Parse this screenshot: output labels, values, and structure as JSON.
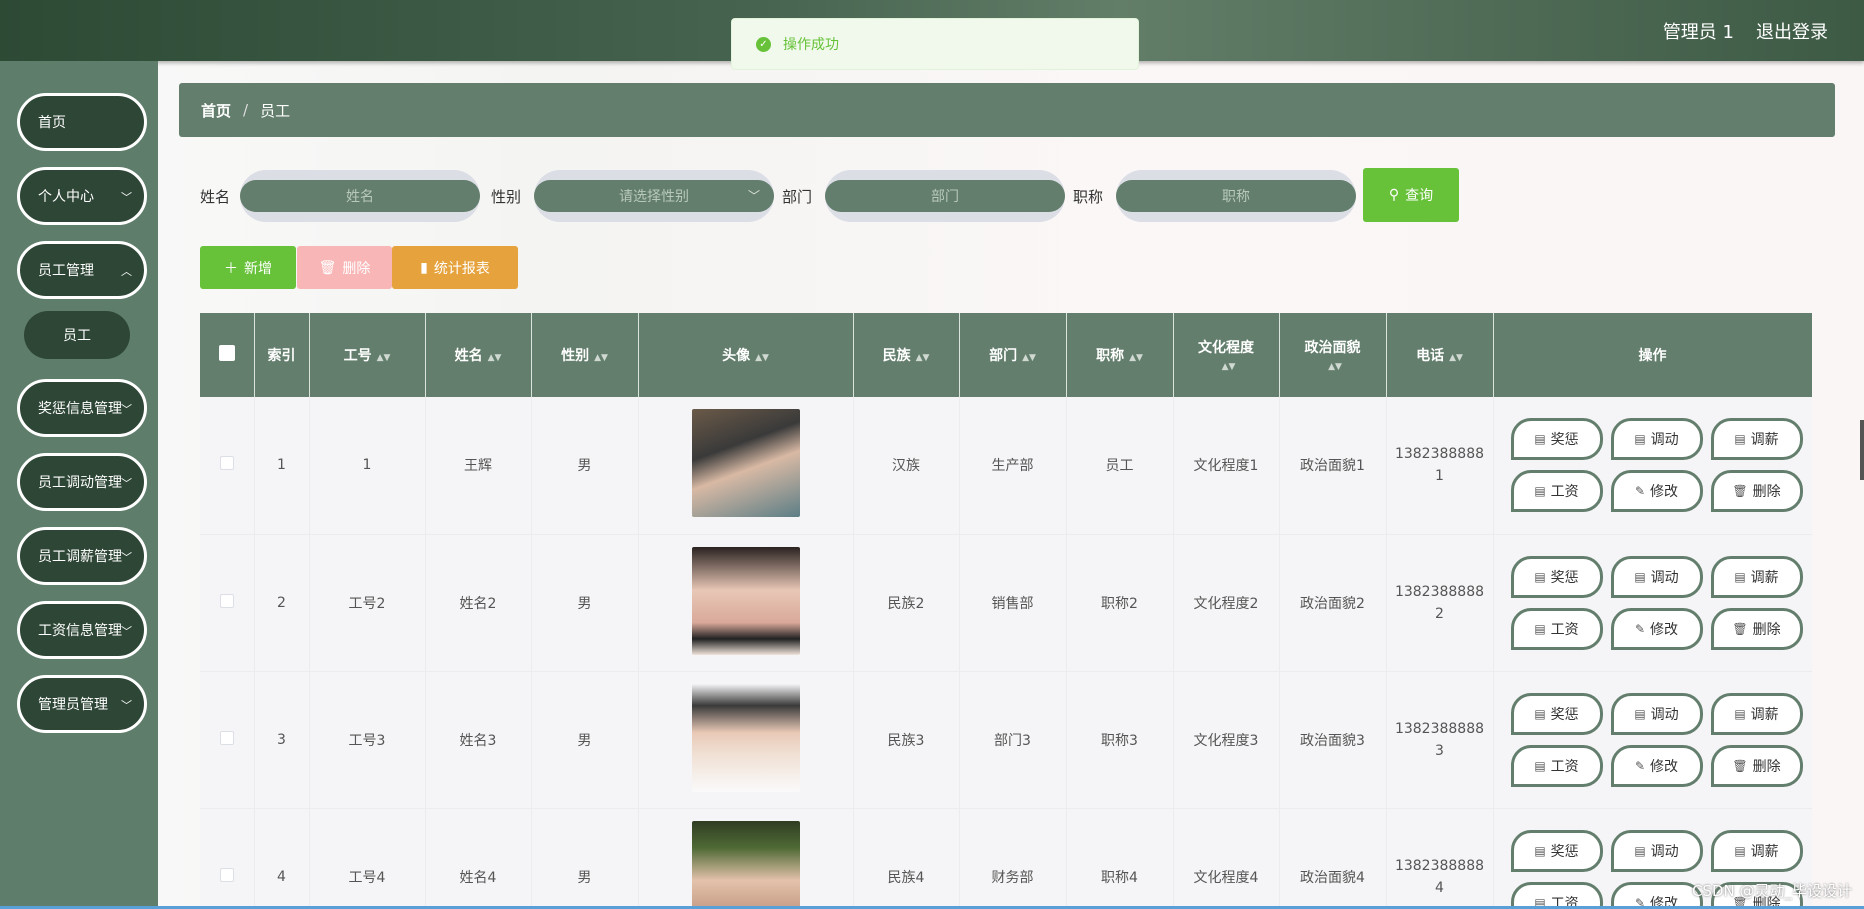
{
  "header": {
    "user": "管理员 1",
    "logout": "退出登录"
  },
  "toast": {
    "message": "操作成功"
  },
  "sidebar": {
    "items": [
      {
        "label": "首页",
        "has_arrow": false
      },
      {
        "label": "个人中心",
        "has_arrow": true
      },
      {
        "label": "员工管理",
        "has_arrow": true
      },
      {
        "label": "奖惩信息管理",
        "has_arrow": true
      },
      {
        "label": "员工调动管理",
        "has_arrow": true
      },
      {
        "label": "员工调薪管理",
        "has_arrow": true
      },
      {
        "label": "工资信息管理",
        "has_arrow": true
      },
      {
        "label": "管理员管理",
        "has_arrow": true
      }
    ],
    "sub_item": "员工"
  },
  "breadcrumb": {
    "home": "首页",
    "current": "员工",
    "separator": "/"
  },
  "search": {
    "name_label": "姓名",
    "name_placeholder": "姓名",
    "gender_label": "性别",
    "gender_placeholder": "请选择性别",
    "dept_label": "部门",
    "dept_placeholder": "部门",
    "title_label": "职称",
    "title_placeholder": "职称",
    "query_button": "查询"
  },
  "actions": {
    "add": "新增",
    "delete": "删除",
    "report": "统计报表"
  },
  "table": {
    "columns": [
      "索引",
      "工号",
      "姓名",
      "性别",
      "头像",
      "民族",
      "部门",
      "职称",
      "文化程度",
      "政治面貌",
      "电话",
      "操作"
    ],
    "rows": [
      {
        "index": "1",
        "emp_no": "1",
        "name": "王辉",
        "gender": "男",
        "ethnicity": "汉族",
        "dept": "生产部",
        "title": "员工",
        "education": "文化程度1",
        "political": "政治面貌1",
        "phone": "13823888881"
      },
      {
        "index": "2",
        "emp_no": "工号2",
        "name": "姓名2",
        "gender": "男",
        "ethnicity": "民族2",
        "dept": "销售部",
        "title": "职称2",
        "education": "文化程度2",
        "political": "政治面貌2",
        "phone": "13823888882"
      },
      {
        "index": "3",
        "emp_no": "工号3",
        "name": "姓名3",
        "gender": "男",
        "ethnicity": "民族3",
        "dept": "部门3",
        "title": "职称3",
        "education": "文化程度3",
        "political": "政治面貌3",
        "phone": "13823888883"
      },
      {
        "index": "4",
        "emp_no": "工号4",
        "name": "姓名4",
        "gender": "男",
        "ethnicity": "民族4",
        "dept": "财务部",
        "title": "职称4",
        "education": "文化程度4",
        "political": "政治面貌4",
        "phone": "13823888884"
      }
    ],
    "row_ops": [
      "奖惩",
      "调动",
      "调薪",
      "工资",
      "修改",
      "删除"
    ]
  },
  "watermark": "CSDN @灵动_毕设设计",
  "colors": {
    "primary": "#637e6c",
    "dark": "#2e4636",
    "success": "#67c23a",
    "warning": "#e6a23c",
    "danger_light": "#f9b6b6"
  }
}
